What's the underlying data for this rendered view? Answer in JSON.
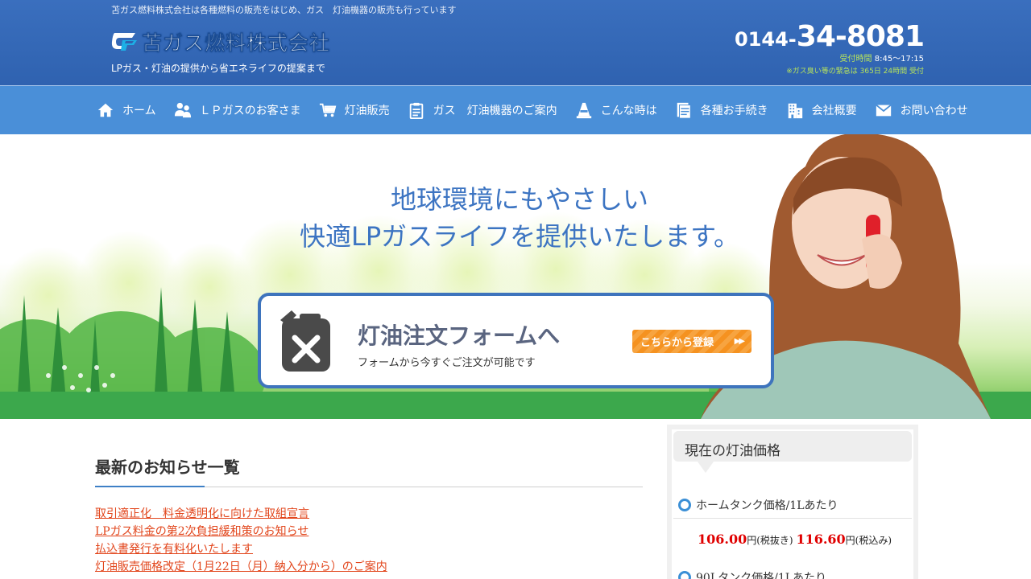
{
  "header": {
    "tagline": "苫ガス燃料株式会社は各種燃料の販売をはじめ、ガス　灯油機器の販売も行っています",
    "company_name": "苫ガス燃料株式会社",
    "logo_sub": "LPガス・灯油の提供から省エネライフの提案まで",
    "phone_area": "0144-",
    "phone_main": "34-8081",
    "hours_label": "受付時間",
    "hours": "8:45〜17:15",
    "emergency": "※ガス臭い等の緊急は 365日 24時間 受付"
  },
  "nav": {
    "items": [
      {
        "label": "ホーム",
        "icon": "home-icon"
      },
      {
        "label": "ＬＰガスのお客さま",
        "icon": "users-icon"
      },
      {
        "label": "灯油販売",
        "icon": "cart-icon"
      },
      {
        "label": "ガス　灯油機器のご案内",
        "icon": "clipboard-icon"
      },
      {
        "label": "こんな時は",
        "icon": "cone-icon"
      },
      {
        "label": "各種お手続き",
        "icon": "document-icon"
      },
      {
        "label": "会社概要",
        "icon": "building-icon"
      },
      {
        "label": "お問い合わせ",
        "icon": "mail-icon"
      }
    ]
  },
  "hero": {
    "headline_line1": "地球環境にもやさしい",
    "headline_line2": "快適LPガスライフを提供いたします。",
    "order_title": "灯油注文フォームへ",
    "order_sub": "フォームから今すぐご注文が可能です",
    "order_button": "こちらから登録",
    "order_button_arrows": "▶▶"
  },
  "news": {
    "title": "最新のお知らせ一覧",
    "items": [
      "取引適正化　料金透明化に向けた取組宣言",
      "LPガス料金の第2次負担緩和策のお知らせ",
      "払込書発行を有料化いたします",
      "灯油販売価格改定（1月22日（月）納入分から）のご案内"
    ]
  },
  "sidebar": {
    "title": "現在の灯油価格",
    "prices": [
      {
        "label": "ホームタンク価格/1Lあたり",
        "excl": "106.00",
        "excl_unit": "円(税抜き)",
        "incl": "116.60",
        "incl_unit": "円(税込み)"
      },
      {
        "label": "90Lタンク価格/1Lあたり"
      }
    ]
  },
  "colors": {
    "header_blue": "#2f62b0",
    "nav_blue": "#4a8fd8",
    "link_red": "#e2461c",
    "price_red": "#e00000",
    "button_orange": "#f59220"
  }
}
